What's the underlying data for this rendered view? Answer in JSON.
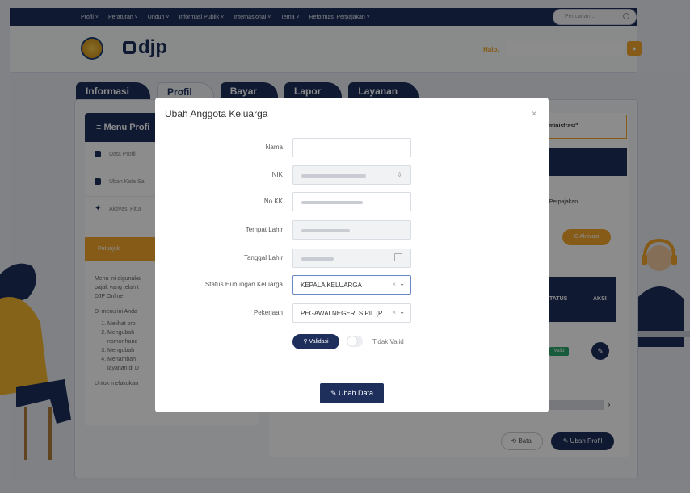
{
  "topnav": {
    "items": [
      "Profil ˅",
      "Peraturan ˅",
      "Unduh ˅",
      "Informasi Publik ˅",
      "Internasional ˅",
      "Tema ˅",
      "Reformasi Perpajakan ˅"
    ],
    "search_placeholder": "Pencarian..."
  },
  "header": {
    "logo_text": "djp",
    "greeting": "Halo,"
  },
  "tabs": [
    "Informasi",
    "Profil",
    "Bayar",
    "Lapor",
    "Layanan"
  ],
  "sidebar": {
    "title": "≡  Menu Profi",
    "items": [
      "Data Profil",
      "Ubah Kata Sa",
      "Aktivasi Fitur"
    ],
    "petunjuk": "Petunjuk",
    "text1": "Menu ini digunaka",
    "text2": "pajak yang telah t",
    "text3": "DJP Online",
    "text4": "Di menu ini Anda",
    "list": [
      "Melihat pro",
      "Mengubah",
      "nomor hand",
      "Mengubah",
      "Menambah",
      "layanan di D"
    ],
    "footer": "Untuk melakukan"
  },
  "background": {
    "notice": "ministrasi\"",
    "info_perpajakan": "nfo Perpajakan",
    "aktivasi": "C  Aktivasi",
    "col_status": "TATUS",
    "col_aksi": "AKSI",
    "valid_badge": "Valid",
    "batal": "Batal",
    "ubah_profil": "Ubah Profil"
  },
  "modal": {
    "title": "Ubah Anggota Keluarga",
    "close": "×",
    "fields": [
      {
        "label": "Nama"
      },
      {
        "label": "NIK"
      },
      {
        "label": "No KK"
      },
      {
        "label": "Tempat Lahir"
      },
      {
        "label": "Tanggal Lahir"
      },
      {
        "label": "Status Hubungan Keluarga",
        "value": "KEPALA KELUARGA"
      },
      {
        "label": "Pekerjaan",
        "value": "PEGAWAI NEGERI SIPIL (P..."
      }
    ],
    "validasi": "Validasi",
    "tidak_valid": "Tidak Valid",
    "ubah_data": "Ubah Data"
  },
  "colors": {
    "navy": "#1e2f5c",
    "gold": "#f2a72b",
    "valid_green": "#2aa66a"
  }
}
